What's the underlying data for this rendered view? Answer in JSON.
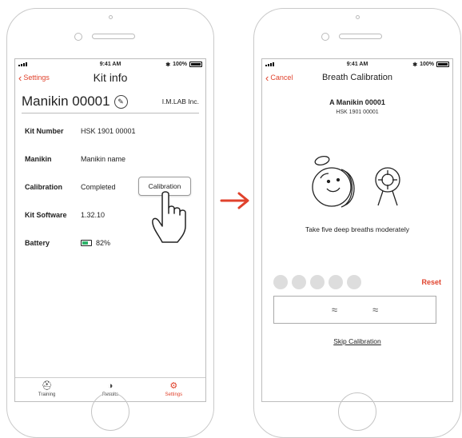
{
  "status": {
    "time": "9:41 AM",
    "battery": "100%"
  },
  "kit_info": {
    "back_label": "Settings",
    "title": "Kit info",
    "kit_name": "Manikin 00001",
    "manufacturer": "I.M.LAB Inc.",
    "rows": [
      {
        "label": "Kit Number",
        "value": "HSK 1901 00001"
      },
      {
        "label": "Manikin",
        "value": "Manikin name"
      },
      {
        "label": "Calibration",
        "value": "Completed"
      },
      {
        "label": "Kit Software",
        "value": "1.32.10"
      },
      {
        "label": "Battery",
        "value": "82%"
      }
    ],
    "calibration_button": "Calibration",
    "battery_level": 0.82,
    "tabs": [
      {
        "label": "Training",
        "icon": "manikin-icon"
      },
      {
        "label": "Results",
        "icon": "results-icon"
      },
      {
        "label": "Settings",
        "icon": "gear-icon",
        "active": true
      }
    ]
  },
  "calibration": {
    "back_label": "Cancel",
    "title": "Breath Calibration",
    "manikin_name": "A Manikin 00001",
    "kit_number": "HSK 1901 00001",
    "instruction": "Take five deep breaths moderately",
    "breath_count_done": 0,
    "breath_count_total": 5,
    "reset_label": "Reset",
    "skip_label": "Skip Calibration"
  },
  "colors": {
    "accent": "#e0422c",
    "battery_green": "#2db36a",
    "inactive_circle": "#dddddd"
  }
}
